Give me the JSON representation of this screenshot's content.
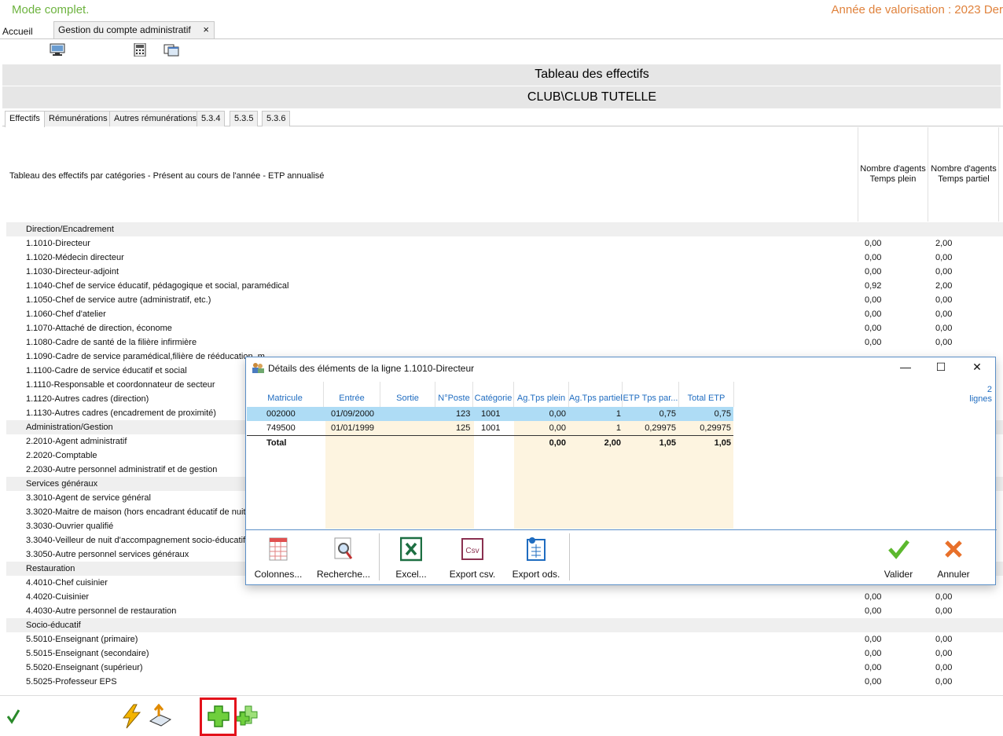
{
  "header": {
    "mode": "Mode complet.",
    "year": "Année de valorisation : 2023 Der"
  },
  "tabs": {
    "home": "Accueil",
    "doc": "Gestion du compte administratif",
    "close": "×"
  },
  "title": {
    "main": "Tableau des effectifs",
    "entity": "CLUB\\CLUB TUTELLE"
  },
  "subtabs": [
    "Effectifs",
    "Rémunérations",
    "Autres rémunérations",
    "5.3.4",
    "5.3.5",
    "5.3.6"
  ],
  "grid": {
    "label": "Tableau des effectifs par catégories - Présent au cours de l'année - ETP annualisé",
    "col1_line1": "Nombre d'agents",
    "col1_line2": "Temps plein",
    "col2_line1": "Nombre d'agents",
    "col2_line2": "Temps partiel",
    "rows": [
      {
        "label": "Direction/Encadrement",
        "group": true
      },
      {
        "label": "1.1010-Directeur",
        "v1": "0,00",
        "v2": "2,00"
      },
      {
        "label": "1.1020-Médecin directeur",
        "v1": "0,00",
        "v2": "0,00"
      },
      {
        "label": "1.1030-Directeur-adjoint",
        "v1": "0,00",
        "v2": "0,00"
      },
      {
        "label": "1.1040-Chef de service éducatif, pédagogique et social, paramédical",
        "v1": "0,92",
        "v2": "2,00"
      },
      {
        "label": "1.1050-Chef de service autre (administratif, etc.)",
        "v1": "0,00",
        "v2": "0,00"
      },
      {
        "label": "1.1060-Chef d'atelier",
        "v1": "0,00",
        "v2": "0,00"
      },
      {
        "label": "1.1070-Attaché de direction, économe",
        "v1": "0,00",
        "v2": "0,00"
      },
      {
        "label": "1.1080-Cadre de santé de la filière infirmière",
        "v1": "0,00",
        "v2": "0,00"
      },
      {
        "label": "1.1090-Cadre de service paramédical,filière de rééducation, m",
        "v1": "",
        "v2": ""
      },
      {
        "label": "1.1100-Cadre de service éducatif et social",
        "v1": "",
        "v2": ""
      },
      {
        "label": "1.1110-Responsable et coordonnateur de secteur",
        "v1": "",
        "v2": ""
      },
      {
        "label": "1.1120-Autres cadres (direction)",
        "v1": "",
        "v2": ""
      },
      {
        "label": "1.1130-Autres cadres (encadrement de proximité)",
        "v1": "",
        "v2": ""
      },
      {
        "label": "Administration/Gestion",
        "group": true
      },
      {
        "label": "2.2010-Agent administratif",
        "v1": "",
        "v2": ""
      },
      {
        "label": "2.2020-Comptable",
        "v1": "",
        "v2": ""
      },
      {
        "label": "2.2030-Autre personnel administratif et de gestion",
        "v1": "",
        "v2": ""
      },
      {
        "label": "Services généraux",
        "group": true
      },
      {
        "label": "3.3010-Agent de service général",
        "v1": "",
        "v2": ""
      },
      {
        "label": "3.3020-Maitre de maison (hors encadrant éducatif de nuit)",
        "v1": "",
        "v2": ""
      },
      {
        "label": "3.3030-Ouvrier qualifié",
        "v1": "",
        "v2": ""
      },
      {
        "label": "3.3040-Veilleur de nuit d'accompagnement socio-éducatif",
        "v1": "",
        "v2": ""
      },
      {
        "label": "3.3050-Autre personnel services généraux",
        "v1": "",
        "v2": ""
      },
      {
        "label": "Restauration",
        "group": true
      },
      {
        "label": "4.4010-Chef cuisinier",
        "v1": "",
        "v2": ""
      },
      {
        "label": "4.4020-Cuisinier",
        "v1": "0,00",
        "v2": "0,00"
      },
      {
        "label": "4.4030-Autre personnel de restauration",
        "v1": "0,00",
        "v2": "0,00"
      },
      {
        "label": "Socio-éducatif",
        "group": true
      },
      {
        "label": "5.5010-Enseignant (primaire)",
        "v1": "0,00",
        "v2": "0,00"
      },
      {
        "label": "5.5015-Enseignant (secondaire)",
        "v1": "0,00",
        "v2": "0,00"
      },
      {
        "label": "5.5020-Enseignant (supérieur)",
        "v1": "0,00",
        "v2": "0,00"
      },
      {
        "label": "5.5025-Professeur EPS",
        "v1": "0,00",
        "v2": "0,00"
      }
    ]
  },
  "dialog": {
    "title": "Détails des éléments de la ligne 1.1010-Directeur",
    "minimize": "—",
    "maximize": "☐",
    "close": "✕",
    "count_value": "2",
    "count_unit": "lignes",
    "columns": [
      "Matricule",
      "Entrée",
      "Sortie",
      "N°Poste",
      "Catégorie",
      "Ag.Tps plein",
      "Ag.Tps partiel",
      "ETP Tps par...",
      "Total ETP"
    ],
    "rows": [
      {
        "matricule": "002000",
        "entree": "01/09/2000",
        "sortie": "",
        "poste": "123",
        "categorie": "1001",
        "plein": "0,00",
        "partiel": "1",
        "etp_par": "0,75",
        "total": "0,75"
      },
      {
        "matricule": "749500",
        "entree": "01/01/1999",
        "sortie": "",
        "poste": "125",
        "categorie": "1001",
        "plein": "0,00",
        "partiel": "1",
        "etp_par": "0,29975",
        "total": "0,29975"
      }
    ],
    "total": {
      "label": "Total",
      "plein": "0,00",
      "partiel": "2,00",
      "etp_par": "1,05",
      "total": "1,05"
    },
    "tools": {
      "columns": "Colonnes...",
      "search": "Recherche...",
      "excel": "Excel...",
      "csv": "Export csv.",
      "ods": "Export ods.",
      "validate": "Valider",
      "cancel": "Annuler"
    }
  },
  "colors": {
    "mode": "#6db33f",
    "year": "#e0823c",
    "selected_row": "#aedcf5",
    "link_blue": "#1f6cc0",
    "highlight": "#e3121b"
  }
}
